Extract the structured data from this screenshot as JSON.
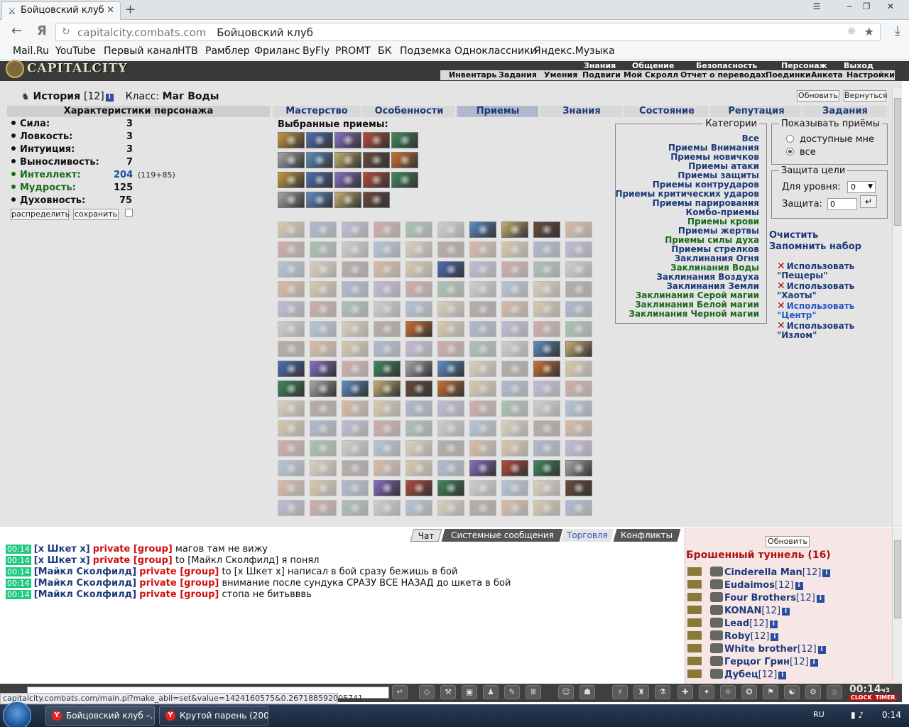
{
  "browser": {
    "tab_title": "Бойцовский клуб",
    "address_domain": "capitalcity.combats.com",
    "address_title": "Бойцовский клуб",
    "bookmarks": [
      "Mail.Ru",
      "YouTube",
      "Первый канал",
      "НТВ",
      "Рамблер",
      "Фриланс",
      "ByFly",
      "PROMT",
      "БК",
      "Подземка",
      "Одноклассники",
      "Яндекс.Музыка"
    ]
  },
  "game": {
    "logo": "CAPITALCITY",
    "top_menu": [
      "Знания",
      "Общение",
      "Безопасность",
      "Персонаж",
      "Выход"
    ],
    "sub_menu": [
      "Инвентарь",
      "Задания",
      "Умения",
      "Подвиги",
      "Мой Скролл",
      "Отчет о переводах",
      "Поединки",
      "Анкета",
      "Настройки"
    ],
    "char_name": "История",
    "char_level": "[12]",
    "class_label": "Класс:",
    "class_value": "Маг Воды",
    "refresh": "Обновить",
    "back": "Вернуться",
    "char_header": "Характеристики персонажа",
    "stats": [
      {
        "name": "Сила:",
        "value": "3"
      },
      {
        "name": "Ловкость:",
        "value": "3"
      },
      {
        "name": "Интуиция:",
        "value": "3"
      },
      {
        "name": "Выносливость:",
        "value": "7"
      },
      {
        "name": "Интеллект:",
        "value": "204",
        "bonus": "(119+85)"
      },
      {
        "name": "Мудрость:",
        "value": "125"
      },
      {
        "name": "Духовность:",
        "value": "75"
      }
    ],
    "distribute": "распределить",
    "save": "сохранить",
    "tabs": [
      "Мастерство",
      "Особенности",
      "Приемы",
      "Знания",
      "Состояние",
      "Репутация",
      "Задания"
    ],
    "active_tab": "Приемы",
    "selected_label": "Выбранные приемы:",
    "categories_legend": "Категории",
    "categories": [
      {
        "label": "Все",
        "green": false
      },
      {
        "label": "Приемы Внимания",
        "green": false
      },
      {
        "label": "Приемы новичков",
        "green": false
      },
      {
        "label": "Приемы атаки",
        "green": false
      },
      {
        "label": "Приемы защиты",
        "green": false
      },
      {
        "label": "Приемы контрударов",
        "green": false
      },
      {
        "label": "Приемы критических ударов",
        "green": false
      },
      {
        "label": "Приемы парирования",
        "green": false
      },
      {
        "label": "Комбо-приемы",
        "green": false
      },
      {
        "label": "Приемы крови",
        "green": true
      },
      {
        "label": "Приемы жертвы",
        "green": false
      },
      {
        "label": "Приемы силы духа",
        "green": true
      },
      {
        "label": "Приемы стрелков",
        "green": false
      },
      {
        "label": "Заклинания Огня",
        "green": false
      },
      {
        "label": "Заклинания Воды",
        "green": true
      },
      {
        "label": "Заклинания Воздуха",
        "green": false
      },
      {
        "label": "Заклинания Земли",
        "green": false
      },
      {
        "label": "Заклинания Серой магии",
        "green": true
      },
      {
        "label": "Заклинания Белой магии",
        "green": true
      },
      {
        "label": "Заклинания Черной магии",
        "green": true
      }
    ],
    "show_legend": "Показывать приёмы",
    "show_available": "доступные мне",
    "show_all": "все",
    "prot_legend": "Защита цели",
    "prot_level_label": "Для уровня:",
    "prot_level_value": "0",
    "prot_label": "Защита:",
    "prot_value": "0",
    "clear": "Очистить",
    "remember": "Запомнить набор",
    "use_sets": [
      {
        "line1": "Использовать",
        "line2": "\"Пещеры\""
      },
      {
        "line1": "Использовать",
        "line2": "\"Хаоты\""
      },
      {
        "line1": "Использовать",
        "line2": "\"Центр\""
      },
      {
        "line1": "Использовать",
        "line2": "\"Излом\""
      }
    ]
  },
  "chat": {
    "tabs": [
      "Чат",
      "Системные сообщения",
      "Торговля",
      "Конфликты"
    ],
    "messages": [
      {
        "time": "00:14",
        "from": "[x Шкет x]",
        "priv": "private [group]",
        "text": "магов там не вижу"
      },
      {
        "time": "00:14",
        "from": "[x Шкет x]",
        "priv": "private [group]",
        "text": "to [Майкл Сколфилд] я понял"
      },
      {
        "time": "00:14",
        "from": "[Майкл Сколфилд]",
        "priv": "private [group]",
        "text": "to [x Шкет x] написал в бой сразу бежишь в бой"
      },
      {
        "time": "00:14",
        "from": "[Майкл Сколфилд]",
        "priv": "private [group]",
        "text": "внимание после сундука СРАЗУ ВСЕ НАЗАД до шкета в бой"
      },
      {
        "time": "00:14",
        "from": "[Майкл Сколфилд]",
        "priv": "private [group]",
        "text": "стопа не битьвввь"
      }
    ]
  },
  "online": {
    "refresh": "Обновить",
    "location": "Брошенный туннель (16)",
    "players": [
      {
        "name": "Cinderella Man",
        "lvl": "[12]"
      },
      {
        "name": "Eudaimos",
        "lvl": "[12]"
      },
      {
        "name": "Four Brothers",
        "lvl": "[12]"
      },
      {
        "name": "KONAN",
        "lvl": "[12]"
      },
      {
        "name": "Lead",
        "lvl": "[12]"
      },
      {
        "name": "Roby",
        "lvl": "[12]"
      },
      {
        "name": "White brother",
        "lvl": "[12]"
      },
      {
        "name": "Герцог Грин",
        "lvl": "[12]"
      },
      {
        "name": "Дубец",
        "lvl": "[12]"
      }
    ]
  },
  "toolbar": {
    "clock": "00:14",
    "clock_suffix": "ч3",
    "clock_label": "CLOCK",
    "timer_label": "TIMER"
  },
  "status_url": "capitalcity.combats.com/main.pl?make_abil=set&value=1424160575&0.267188592005741",
  "taskbar": {
    "tasks": [
      "Бойцовский клуб –...",
      "Крутой парень (200..."
    ],
    "lang": "RU",
    "time": "0:14"
  }
}
